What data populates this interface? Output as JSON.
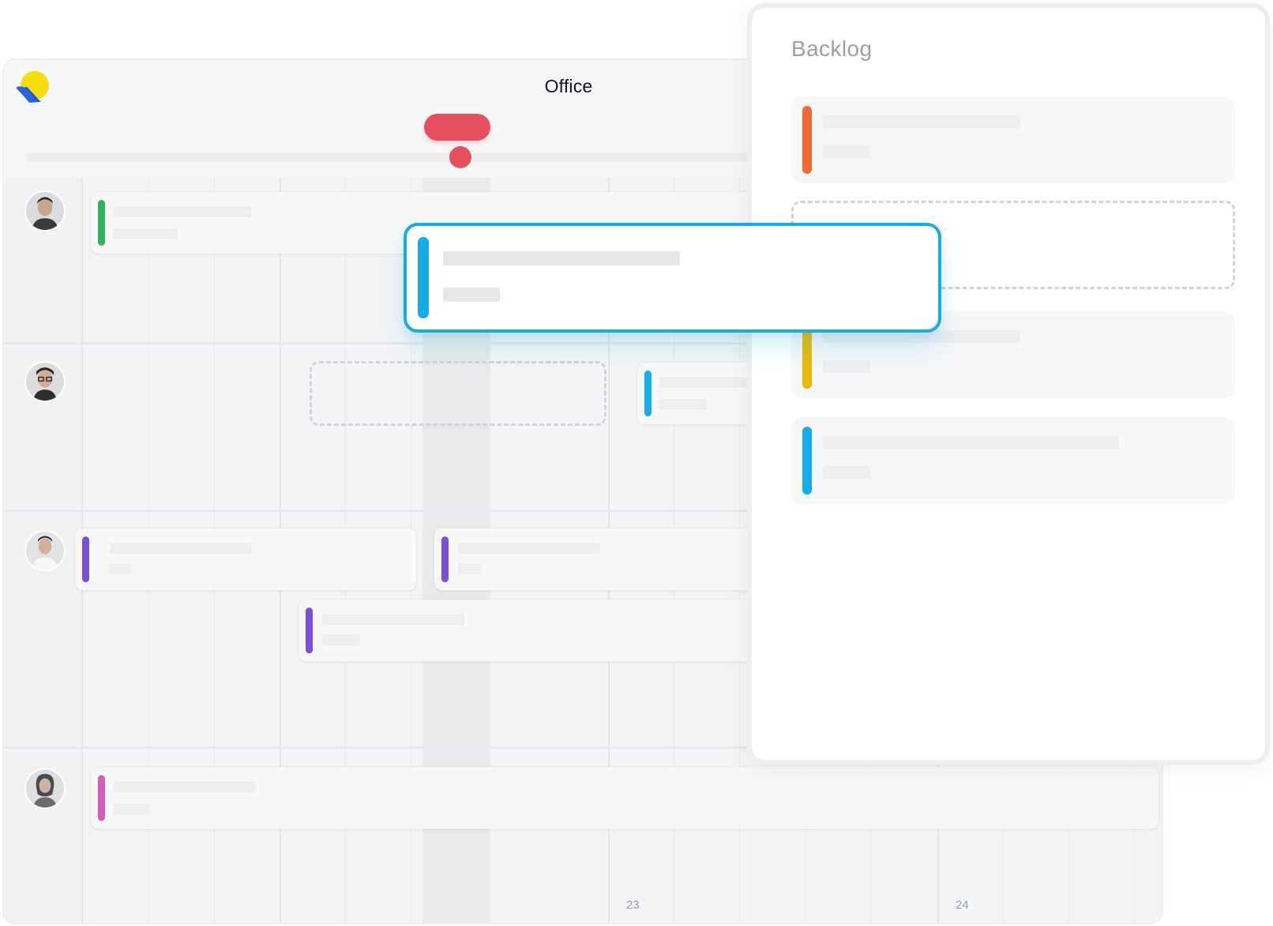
{
  "app": {
    "workspace_title": "Office",
    "logo_icon": "app-logo-icon"
  },
  "timeline": {
    "day_numbers": [
      "23",
      "24"
    ],
    "now_marker_color": "#e5505f"
  },
  "people": [
    {
      "avatar_icon": "avatar-person-1",
      "tasks": [
        {
          "color": "#2fb45a"
        }
      ]
    },
    {
      "avatar_icon": "avatar-person-2",
      "tasks": [
        {
          "color": "#18ace6"
        }
      ]
    },
    {
      "avatar_icon": "avatar-person-3",
      "tasks": [
        {
          "color": "#7b4fd8"
        },
        {
          "color": "#7b4fd8"
        },
        {
          "color": "#7b4fd8"
        }
      ]
    },
    {
      "avatar_icon": "avatar-person-4",
      "tasks": [
        {
          "color": "#d85cc0"
        }
      ]
    }
  ],
  "backlog": {
    "title": "Backlog",
    "cards": [
      {
        "color": "#ee6b33"
      },
      {
        "color": "#e8b90c"
      },
      {
        "color": "#18ace6"
      }
    ]
  },
  "dragged_task": {
    "color": "#18ace6"
  }
}
